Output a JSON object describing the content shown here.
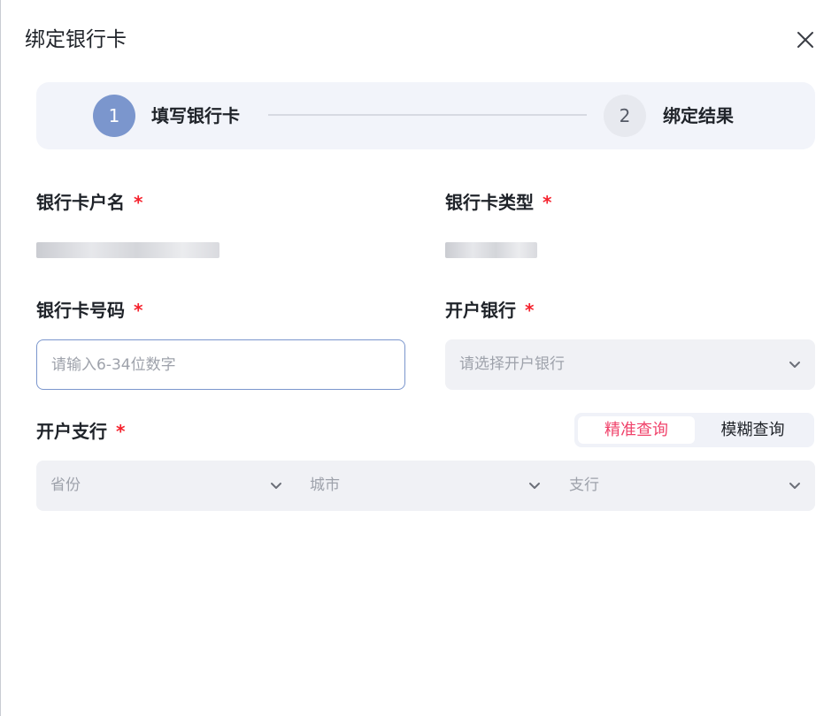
{
  "dialog": {
    "title": "绑定银行卡",
    "close_icon": "close-icon"
  },
  "steps": [
    {
      "number": "1",
      "label": "填写银行卡",
      "state": "active"
    },
    {
      "number": "2",
      "label": "绑定结果",
      "state": "pending"
    }
  ],
  "form": {
    "account_name": {
      "label": "银行卡户名",
      "required_mark": "*"
    },
    "card_type": {
      "label": "银行卡类型",
      "required_mark": "*"
    },
    "card_number": {
      "label": "银行卡号码",
      "required_mark": "*",
      "placeholder": "请输入6-34位数字",
      "value": ""
    },
    "bank": {
      "label": "开户银行",
      "required_mark": "*",
      "placeholder": "请选择开户银行"
    },
    "branch": {
      "label": "开户支行",
      "required_mark": "*",
      "query_modes": [
        {
          "label": "精准查询",
          "selected": true
        },
        {
          "label": "模糊查询",
          "selected": false
        }
      ],
      "selects": [
        {
          "placeholder": "省份"
        },
        {
          "placeholder": "城市"
        },
        {
          "placeholder": "支行"
        }
      ]
    }
  },
  "colors": {
    "primary": "#7b96cd",
    "required": "#f5222d",
    "active_toggle_text": "#f0436b",
    "panel_bg": "#f2f4fa",
    "field_bg": "#f0f1f5"
  }
}
